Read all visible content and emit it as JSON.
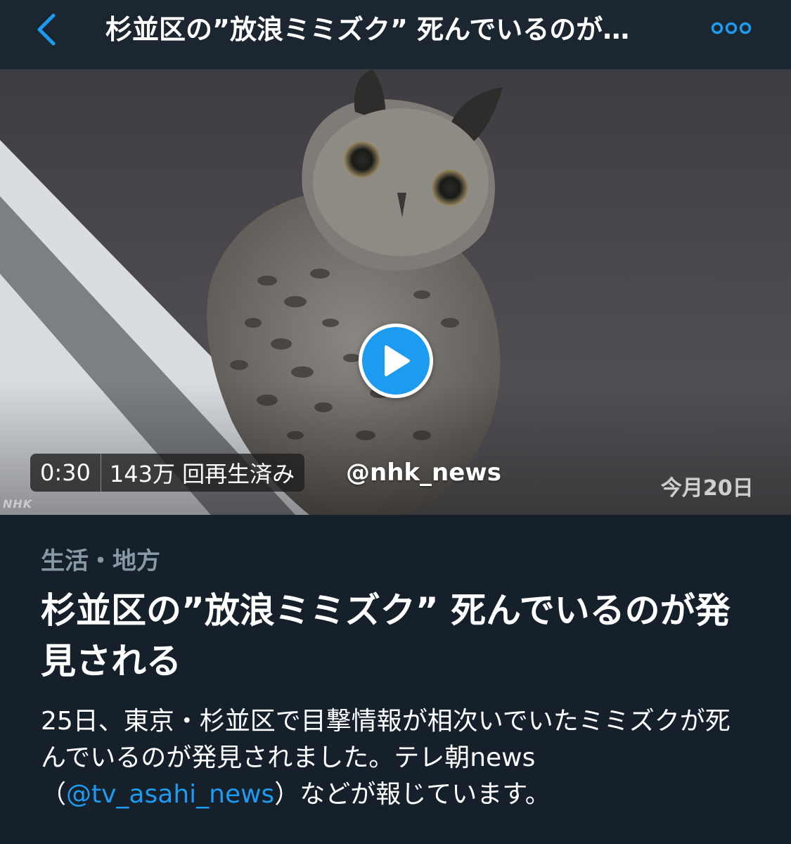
{
  "header": {
    "title": "杉並区の”放浪ミミズク” 死んでいるのが…",
    "back_icon": "chevron-left-icon",
    "more_icon": "more-options-icon",
    "accent_color": "#1d9bf0"
  },
  "video": {
    "duration": "0:30",
    "views": "143万 回再生済み",
    "handle": "@nhk_news",
    "date_stamp": "今月20日",
    "watermark": "NHK",
    "play_icon": "play-icon"
  },
  "article": {
    "category": "生活・地方",
    "headline": "杉並区の”放浪ミミズク” 死んでいるのが発見される",
    "description_before": "25日、東京・杉並区で目撃情報が相次いでいたミミズクが死んでいるのが発見されました。テレ朝news（",
    "mention": "@tv_asahi_news",
    "description_after": "）などが報じています。"
  }
}
